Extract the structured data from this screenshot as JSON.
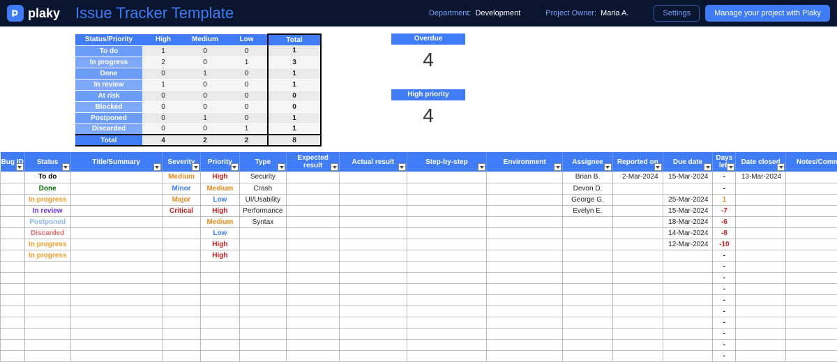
{
  "header": {
    "brand": "plaky",
    "title": "Issue Tracker Template",
    "department_label": "Department:",
    "department_value": "Development",
    "owner_label": "Project Owner:",
    "owner_value": "Maria A.",
    "settings_btn": "Settings",
    "manage_btn": "Manage your project with Plaky"
  },
  "pivot": {
    "corner": "Status/Priority",
    "cols": [
      "High",
      "Medium",
      "Low"
    ],
    "total_col": "Total",
    "rows": [
      {
        "label": "To do",
        "v": [
          1,
          0,
          0
        ],
        "t": 1
      },
      {
        "label": "In progress",
        "v": [
          2,
          0,
          1
        ],
        "t": 3
      },
      {
        "label": "Done",
        "v": [
          0,
          1,
          0
        ],
        "t": 1
      },
      {
        "label": "In review",
        "v": [
          1,
          0,
          0
        ],
        "t": 1
      },
      {
        "label": "At risk",
        "v": [
          0,
          0,
          0
        ],
        "t": 0
      },
      {
        "label": "Blocked",
        "v": [
          0,
          0,
          0
        ],
        "t": 0
      },
      {
        "label": "Postponed",
        "v": [
          0,
          1,
          0
        ],
        "t": 1
      },
      {
        "label": "Discarded",
        "v": [
          0,
          0,
          1
        ],
        "t": 1
      }
    ],
    "total_row": {
      "label": "Total",
      "v": [
        4,
        2,
        2
      ],
      "t": 8
    }
  },
  "cards": {
    "overdue": {
      "label": "Overdue",
      "value": 4
    },
    "high_priority": {
      "label": "High priority",
      "value": 4
    }
  },
  "grid": {
    "columns": [
      {
        "key": "bug_id",
        "label": "Bug ID",
        "w": 34
      },
      {
        "key": "status",
        "label": "Status",
        "w": 64
      },
      {
        "key": "title",
        "label": "Title/Summary",
        "w": 128
      },
      {
        "key": "severity",
        "label": "Severity",
        "w": 54
      },
      {
        "key": "priority",
        "label": "Priority",
        "w": 54
      },
      {
        "key": "type",
        "label": "Type",
        "w": 66
      },
      {
        "key": "expected",
        "label": "Expected result",
        "w": 74
      },
      {
        "key": "actual",
        "label": "Actual result",
        "w": 94
      },
      {
        "key": "steps",
        "label": "Step-by-step",
        "w": 112
      },
      {
        "key": "env",
        "label": "Environment",
        "w": 106
      },
      {
        "key": "assignee",
        "label": "Assignee",
        "w": 70
      },
      {
        "key": "reported",
        "label": "Reported on",
        "w": 70
      },
      {
        "key": "due",
        "label": "Due date",
        "w": 70
      },
      {
        "key": "days_left",
        "label": "Days left",
        "w": 32
      },
      {
        "key": "closed",
        "label": "Date closed",
        "w": 70
      },
      {
        "key": "notes",
        "label": "Notes/Comments",
        "w": 110
      }
    ],
    "rows": [
      {
        "status": "To do",
        "severity": "Medium",
        "priority": "High",
        "type": "Security",
        "assignee": "Brian B.",
        "reported": "2-Mar-2024",
        "due": "15-Mar-2024",
        "days_left": "-",
        "closed": "13-Mar-2024"
      },
      {
        "status": "Done",
        "severity": "Minor",
        "priority": "Medium",
        "type": "Crash",
        "assignee": "Devon D.",
        "days_left": "-"
      },
      {
        "status": "In progress",
        "severity": "Major",
        "priority": "Low",
        "type": "UI/Usability",
        "assignee": "George G.",
        "due": "25-Mar-2024",
        "days_left": "1"
      },
      {
        "status": "In review",
        "severity": "Critical",
        "priority": "High",
        "type": "Performance",
        "assignee": "Evelyn E.",
        "due": "15-Mar-2024",
        "days_left": "-7"
      },
      {
        "status": "Postponed",
        "priority": "Medium",
        "type": "Syntax",
        "due": "18-Mar-2024",
        "days_left": "-6"
      },
      {
        "status": "Discarded",
        "priority": "Low",
        "due": "14-Mar-2024",
        "days_left": "-8"
      },
      {
        "status": "In progress",
        "priority": "High",
        "due": "12-Mar-2024",
        "days_left": "-10"
      },
      {
        "status": "In progress",
        "priority": "High",
        "days_left": "-"
      },
      {
        "days_left": "-"
      },
      {
        "days_left": "-"
      },
      {
        "days_left": "-"
      },
      {
        "days_left": "-"
      },
      {
        "days_left": "-"
      },
      {
        "days_left": "-"
      },
      {
        "days_left": "-"
      },
      {
        "days_left": "-"
      },
      {
        "days_left": "-"
      }
    ]
  }
}
